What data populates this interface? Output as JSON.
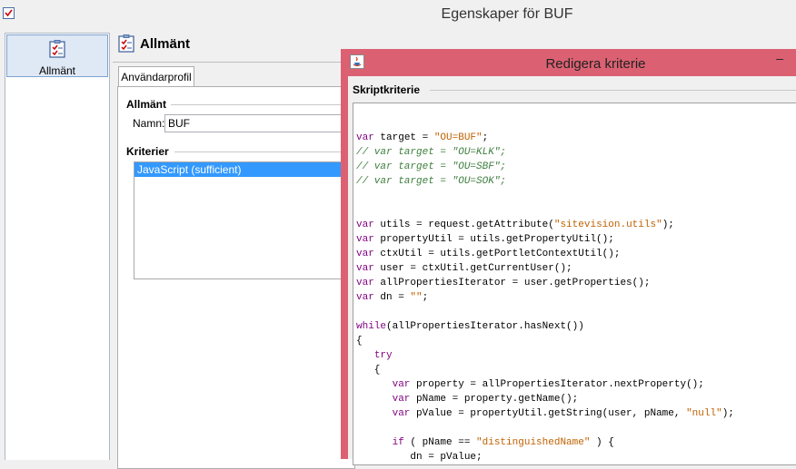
{
  "window": {
    "title": "Egenskaper för BUF",
    "icon": "checklist-icon"
  },
  "nav": {
    "items": [
      {
        "label": "Allmänt",
        "icon": "checklist-icon",
        "selected": true
      }
    ]
  },
  "content": {
    "header_title": "Allmänt",
    "tab_label": "Användarprofil",
    "general": {
      "section_title": "Allmänt",
      "name_label": "Namn:",
      "name_value": "BUF"
    },
    "criteria": {
      "section_title": "Kriterier",
      "items": [
        "JavaScript (sufficient)"
      ]
    }
  },
  "dialog": {
    "title": "Redigera kriterie",
    "minimize_glyph": "–",
    "section_title": "Skriptkriterie",
    "code_lines": [
      "",
      "var target = \"OU=BUF\";",
      "// var target = \"OU=KLK\";",
      "// var target = \"OU=SBF\";",
      "// var target = \"OU=SOK\";",
      "",
      "",
      "var utils = request.getAttribute(\"sitevision.utils\");",
      "var propertyUtil = utils.getPropertyUtil();",
      "var ctxUtil = utils.getPortletContextUtil();",
      "var user = ctxUtil.getCurrentUser();",
      "var allPropertiesIterator = user.getProperties();",
      "var dn = \"\";",
      "",
      "while(allPropertiesIterator.hasNext())",
      "{",
      "   try",
      "   {",
      "      var property = allPropertiesIterator.nextProperty();",
      "      var pName = property.getName();",
      "      var pValue = propertyUtil.getString(user, pName, \"null\");",
      "",
      "      if ( pName == \"distinguishedName\" ) {",
      "         dn = pValue;",
      "      }"
    ]
  },
  "colors": {
    "dialog_titlebar": "#db6172",
    "selection": "#3399ff",
    "nav_selected": "#dfe8f5"
  }
}
